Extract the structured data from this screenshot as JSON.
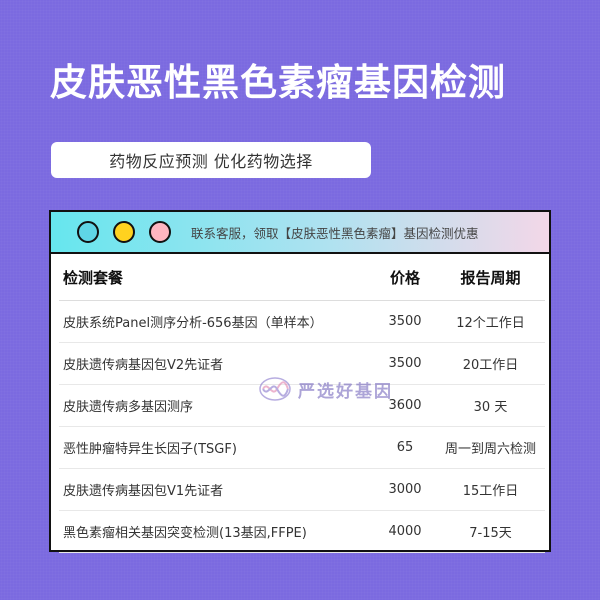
{
  "header": {
    "title": "皮肤恶性黑色素瘤基因检测",
    "subtitle": "药物反应预测 优化药物选择"
  },
  "panel": {
    "promo_text": "联系客服，领取【皮肤恶性黑色素瘤】基因检测优惠",
    "window_dots": [
      "#5fd6e6",
      "#ffd21f",
      "#ffb6c1"
    ],
    "columns": [
      "检测套餐",
      "价格",
      "报告周期"
    ],
    "rows": [
      {
        "name": "皮肤系统Panel测序分析-656基因（单样本）",
        "price": "3500",
        "period": "12个工作日"
      },
      {
        "name": "皮肤遗传病基因包V2先证者",
        "price": "3500",
        "period": "20工作日"
      },
      {
        "name": "皮肤遗传病多基因测序",
        "price": "3600",
        "period": "30 天"
      },
      {
        "name": "恶性肿瘤特异生长因子(TSGF)",
        "price": "65",
        "period": "周一到周六检测"
      },
      {
        "name": "皮肤遗传病基因包V1先证者",
        "price": "3000",
        "period": "15工作日"
      },
      {
        "name": "黑色素瘤相关基因突变检测(13基因,FFPE)",
        "price": "4000",
        "period": "7-15天"
      }
    ]
  },
  "watermark": {
    "text": "严选好基因",
    "icon": "dna-logo-icon"
  },
  "colors": {
    "background": "#7b6ae0",
    "titlebar_gradient_start": "#66e6ee",
    "titlebar_gradient_end": "#f3d7e8"
  }
}
